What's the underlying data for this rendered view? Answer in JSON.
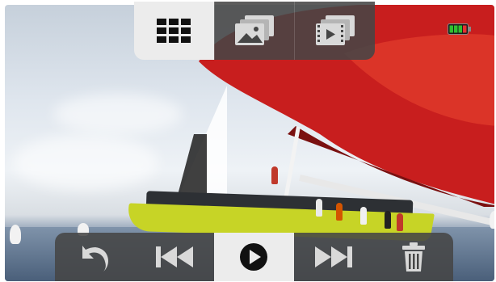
{
  "top_bar": {
    "selected_index": 0,
    "items": [
      {
        "icon": "grid-icon",
        "selected": true
      },
      {
        "icon": "photo-gallery-icon",
        "selected": false
      },
      {
        "icon": "video-gallery-icon",
        "selected": false
      }
    ]
  },
  "bottom_bar": {
    "selected_index": 2,
    "items": [
      {
        "icon": "undo-back-icon"
      },
      {
        "icon": "skip-previous-icon"
      },
      {
        "icon": "play-icon",
        "selected": true
      },
      {
        "icon": "skip-next-icon"
      },
      {
        "icon": "trash-icon"
      }
    ]
  },
  "status": {
    "battery_icon": "battery-icon",
    "battery_level_fraction": 0.75
  },
  "colors": {
    "bar_dark": "#464646",
    "bar_selected": "#ececec",
    "icon_light": "#d9d9d9",
    "icon_dark": "#111111",
    "battery_green": "#2fbf2f",
    "battery_red": "#e53030",
    "sail_red": "#c81e1e",
    "hull_yellow": "#c7d426"
  }
}
